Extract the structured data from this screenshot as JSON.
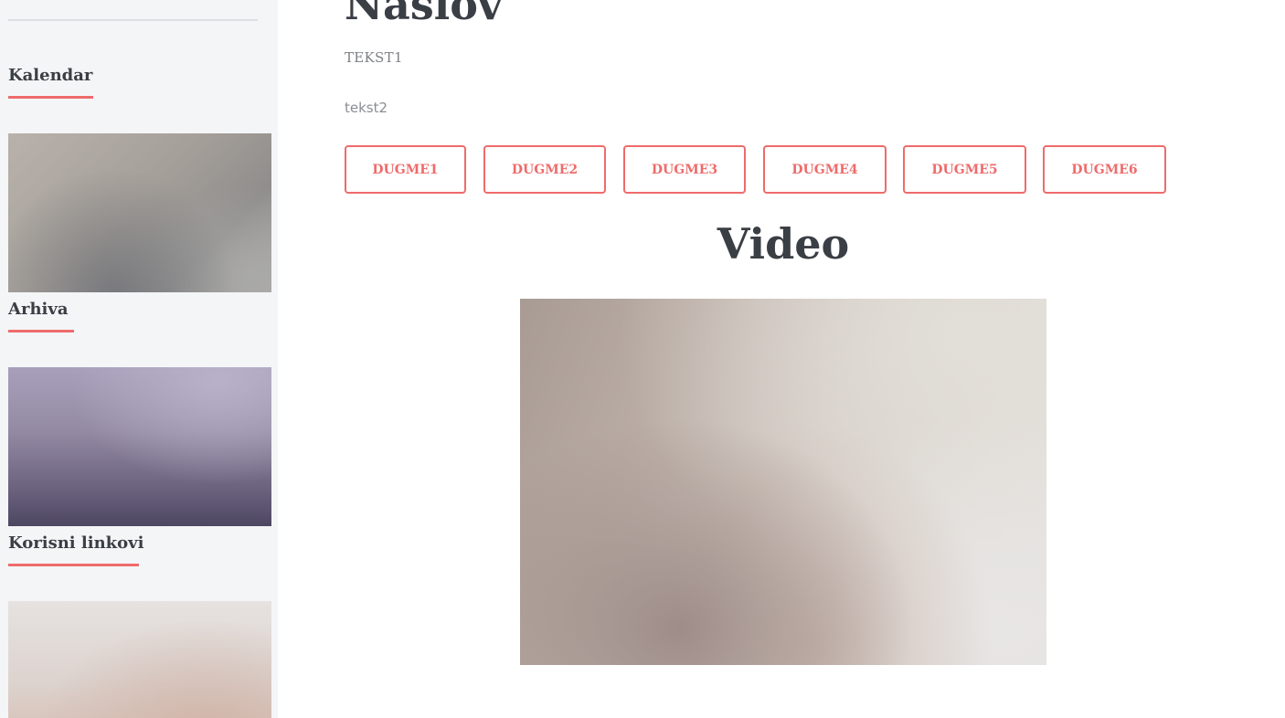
{
  "sidebar": {
    "widgets": [
      {
        "title": "Kalendar",
        "image_name": "kalendar-image"
      },
      {
        "title": "Arhiva",
        "image_name": "arhiva-image"
      },
      {
        "title": "Korisni linkovi",
        "image_name": "korisni-linkovi-image"
      }
    ]
  },
  "main": {
    "title": "Naslov",
    "text1": "TEKST1",
    "text2": "tekst2",
    "buttons": [
      "DUGME1",
      "DUGME2",
      "DUGME3",
      "DUGME4",
      "DUGME5",
      "DUGME6"
    ],
    "video_section_title": "Video"
  },
  "colors": {
    "accent": "#ee6b6b",
    "heading": "#3a3f45",
    "sidebar_bg": "#f4f5f7"
  }
}
